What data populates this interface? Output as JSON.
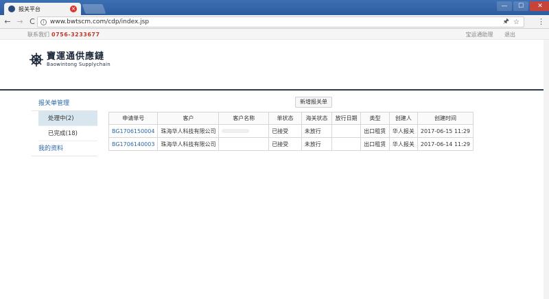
{
  "browser": {
    "tab_title": "报关平台",
    "tab_close": "×",
    "url": "www.bwtscm.com/cdp/index.jsp",
    "back": "←",
    "forward": "→",
    "reload": "C",
    "info": "i",
    "pin": "🖈",
    "star": "☆",
    "menu": "⋮",
    "min": "—",
    "max": "☐",
    "close": "✕"
  },
  "topstrip": {
    "contact_label": "联系我们",
    "phone": "0756-3233677",
    "user": "宝运通助理",
    "logout": "退出"
  },
  "logo": {
    "cn": "寶運通供應鏈",
    "en": "Baowintong Supplychain"
  },
  "sidebar": {
    "head": "报关单管理",
    "items": [
      {
        "label": "处理中(2)"
      },
      {
        "label": "已完成(18)"
      }
    ],
    "profile": "我的资料"
  },
  "main": {
    "add_button": "新增报关单",
    "columns": [
      "申请单号",
      "客户",
      "客户名称",
      "单状态",
      "海关状态",
      "放行日期",
      "类型",
      "创建人",
      "创建时间"
    ],
    "rows": [
      {
        "no": "BG1706150004",
        "customer": "珠海华人科技有限公司",
        "customer_name": "",
        "status": "已接受",
        "customs": "未放行",
        "release": "",
        "type": "出口租赁",
        "creator": "华人报关",
        "time": "2017-06-15 11:29"
      },
      {
        "no": "BG1706140003",
        "customer": "珠海华人科技有限公司",
        "customer_name": "",
        "status": "已接受",
        "customs": "未放行",
        "release": "",
        "type": "出口租赁",
        "creator": "华人报关",
        "time": "2017-06-14 11:29"
      }
    ]
  }
}
